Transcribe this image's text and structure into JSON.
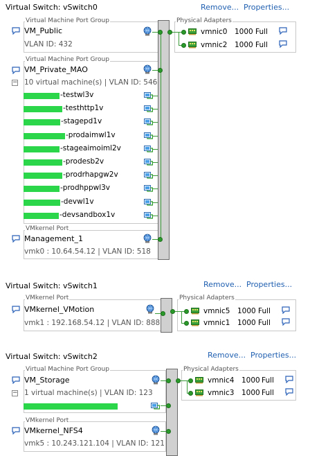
{
  "switches": [
    {
      "title": "Virtual Switch: vSwitch0",
      "remove": "Remove...",
      "properties": "Properties...",
      "groups": [
        {
          "type_label": "Virtual Machine Port Group",
          "name": "VM_Public",
          "detail": "VLAN ID: 432"
        },
        {
          "type_label": "Virtual Machine Port Group",
          "name": "VM_Private_MAO",
          "detail": "10 virtual machine(s) | VLAN ID: 546",
          "vms": [
            "-testwl3v",
            "-testhttp1v",
            "-stagepd1v",
            "-prodaimwl1v",
            "-stageaimoiml2v",
            "-prodesb2v",
            "-prodrhapgw2v",
            "-prodhppwl3v",
            "-devwl1v",
            "-devsandbox1v"
          ]
        },
        {
          "type_label": "VMkernel Port",
          "name": "Management_1",
          "detail": "vmk0 : 10.64.54.12 | VLAN ID: 518"
        }
      ],
      "adapters_label": "Physical Adapters",
      "adapters": [
        {
          "name": "vmnic0",
          "speed": "1000",
          "duplex": "Full"
        },
        {
          "name": "vmnic2",
          "speed": "1000",
          "duplex": "Full"
        }
      ]
    },
    {
      "title": "Virtual Switch: vSwitch1",
      "remove": "Remove...",
      "properties": "Properties...",
      "groups": [
        {
          "type_label": "VMkernel Port",
          "name": "VMkernel_VMotion",
          "detail": "vmk1 : 192.168.54.12 | VLAN ID: 888"
        }
      ],
      "adapters_label": "Physical Adapters",
      "adapters": [
        {
          "name": "vmnic5",
          "speed": "1000",
          "duplex": "Full"
        },
        {
          "name": "vmnic1",
          "speed": "1000",
          "duplex": "Full"
        }
      ]
    },
    {
      "title": "Virtual Switch: vSwitch2",
      "remove": "Remove...",
      "properties": "Properties...",
      "groups": [
        {
          "type_label": "Virtual Machine Port Group",
          "name": "VM_Storage",
          "detail": "1 virtual machine(s) | VLAN ID: 123",
          "vms": [
            ""
          ]
        },
        {
          "type_label": "VMkernel Port",
          "name": "VMkernel_NFS4",
          "detail": "vmk5 : 10.243.121.104 | VLAN ID: 121"
        }
      ],
      "adapters_label": "Physical Adapters",
      "adapters": [
        {
          "name": "vmnic4",
          "speed": "1000",
          "duplex": "Full"
        },
        {
          "name": "vmnic3",
          "speed": "1000",
          "duplex": "Full"
        }
      ]
    }
  ],
  "colors": {
    "link": "#1f5fb0",
    "connection": "#3a9a3a",
    "redaction": "#2bd64a",
    "switch_bar": "#d0d0d0"
  },
  "icons": {
    "comment": "speech-bubble-icon",
    "port_group": "globe-network-icon",
    "vm": "vm-icon",
    "nic": "network-card-icon"
  }
}
